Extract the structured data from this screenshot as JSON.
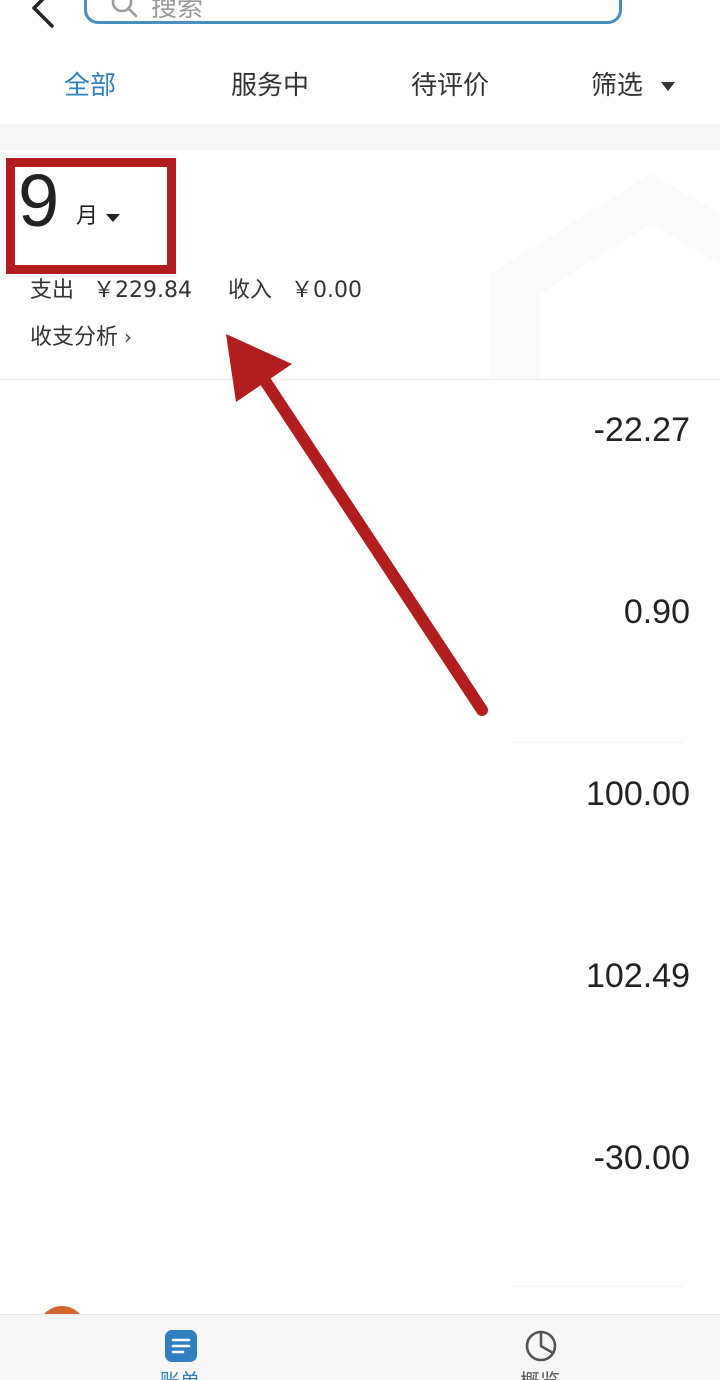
{
  "header": {
    "search_placeholder": "搜索"
  },
  "tabs": [
    {
      "label": "全部",
      "active": true
    },
    {
      "label": "服务中",
      "active": false
    },
    {
      "label": "待评价",
      "active": false
    },
    {
      "label": "筛选",
      "active": false
    }
  ],
  "summary": {
    "month_number": "9",
    "month_unit": "月",
    "expense_label": "支出",
    "expense_value": "￥229.84",
    "income_label": "收入",
    "income_value": "￥0.00",
    "analysis_label": "收支分析",
    "analysis_chevron": "›"
  },
  "records": [
    {
      "amount": "-22.27"
    },
    {
      "amount": "0.90"
    },
    {
      "amount": "100.00"
    },
    {
      "amount": "102.49"
    },
    {
      "amount": "-30.00"
    }
  ],
  "bottom_nav": {
    "bill_label": "账单",
    "overview_label": "概览"
  },
  "colors": {
    "accent": "#2f7fc1",
    "annotation": "#b21e1e",
    "search_border": "#4a8ec2"
  },
  "icons": [
    "back-arrow-icon",
    "search-icon",
    "caret-down-icon",
    "chevron-right-icon",
    "bill-icon",
    "pie-chart-icon"
  ]
}
